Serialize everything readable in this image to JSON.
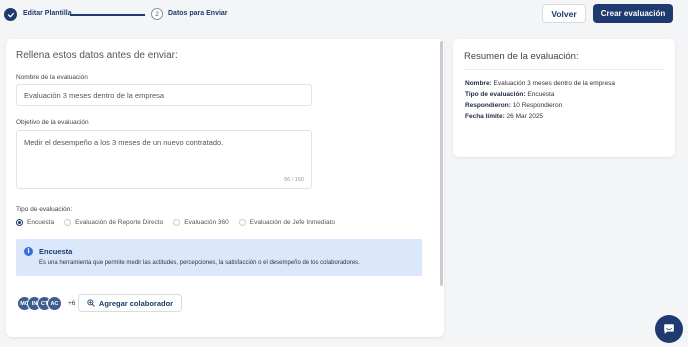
{
  "stepper": {
    "step1_label": "Editar Plantilla",
    "step2_number": "2",
    "step2_label": "Datos para Enviar"
  },
  "header": {
    "back_button": "Volver",
    "create_button": "Crear evaluación"
  },
  "form": {
    "title": "Rellena estos datos antes de enviar:",
    "name_label": "Nombre de la evaluación",
    "name_value": "Evaluación 3 meses dentro de la empresa",
    "objective_label": "Objetivo de la evaluación",
    "objective_value": "Medir el desempeño a los 3 meses de un nuevo contratado.",
    "objective_counter": "56 / 150",
    "type_label": "Tipo de evaluación:",
    "type_options": [
      {
        "label": "Encuesta",
        "selected": true
      },
      {
        "label": "Evaluación de Reporte Directo",
        "selected": false
      },
      {
        "label": "Evaluación 360",
        "selected": false
      },
      {
        "label": "Evaluación de Jefe Inmediato",
        "selected": false
      }
    ],
    "info": {
      "icon_glyph": "i",
      "title": "Encuesta",
      "description": "Es una herramienta que permite medir las actitudes, percepciones, la satisfacción o el desempeño de los colaboradores."
    },
    "collaborators": {
      "avatars": [
        "MC",
        "IN",
        "CT",
        "AC"
      ],
      "more_count": "+6",
      "add_button": "Agregar colaborador"
    }
  },
  "summary": {
    "title": "Resumen de la evaluación:",
    "name_key": "Nombre:",
    "name_val": "Evaluación 3 meses dentro de la empresa",
    "type_key": "Tipo de evaluación:",
    "type_val": "Encuesta",
    "respondents_key": "Respondieron:",
    "respondents_val": "10 Respondieron",
    "deadline_key": "Fecha límite:",
    "deadline_val": "26 Mar 2025"
  },
  "colors": {
    "primary": "#1e3a6e",
    "info_bg": "#dbe8fb",
    "info_icon": "#3a6fd8",
    "page_bg": "#f4f5f7"
  }
}
